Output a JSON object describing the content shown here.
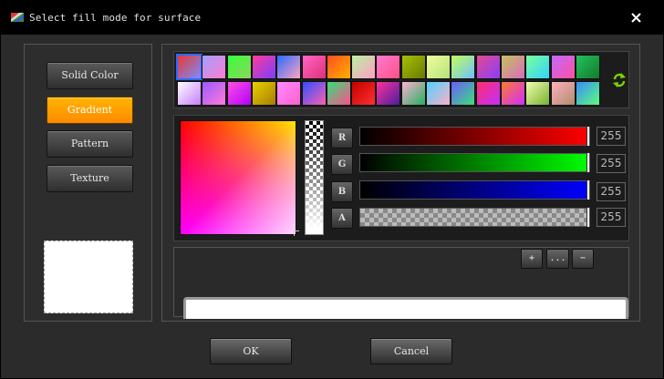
{
  "window": {
    "title": "Select fill mode for surface"
  },
  "fill_modes": [
    {
      "label": "Solid Color",
      "active": false
    },
    {
      "label": "Gradient",
      "active": true
    },
    {
      "label": "Pattern",
      "active": false
    },
    {
      "label": "Texture",
      "active": false
    }
  ],
  "channels": [
    {
      "label": "R",
      "value": "255",
      "fill": "linear-gradient(to right, #000000, #ff0000)"
    },
    {
      "label": "G",
      "value": "255",
      "fill": "linear-gradient(to right, #000000, #00ff00)"
    },
    {
      "label": "B",
      "value": "255",
      "fill": "linear-gradient(to right, #000000, #0000ff)"
    },
    {
      "label": "A",
      "value": "255",
      "fill": "alpha"
    }
  ],
  "gradient_buttons": {
    "add": "+",
    "more": "...",
    "remove": "−"
  },
  "dialog_buttons": {
    "ok": "OK",
    "cancel": "Cancel"
  },
  "colors": {
    "accent": "#ff9c00",
    "selected_outline": "#2a6bff",
    "refresh_icon": "#7bd400"
  },
  "icons": {
    "close": "close-icon",
    "refresh": "refresh-icon",
    "app": "app-icon"
  },
  "swatches": [
    [
      "#e53935",
      "#7b8cff"
    ],
    [
      "#a0a0ff",
      "#ff7bd0"
    ],
    [
      "#36ff3a",
      "#8fd45c"
    ],
    [
      "#ff3d9a",
      "#7a3dff"
    ],
    [
      "#2b6bff",
      "#ffa3c0"
    ],
    [
      "#ff66c4",
      "#e02f7a"
    ],
    [
      "#ff4f1f",
      "#ffb000"
    ],
    [
      "#b9f2a0",
      "#ff9dc5"
    ],
    [
      "#ff7bd1",
      "#ff4f88"
    ],
    [
      "#a5c000",
      "#6b7a00"
    ],
    [
      "#f0ff9a",
      "#b4e27c"
    ],
    [
      "#c3ff5a",
      "#6ec0ff"
    ],
    [
      "#e34b8f",
      "#8a3cff"
    ],
    [
      "#c7c35a",
      "#d96ac0"
    ],
    [
      "#7cff9a",
      "#2fd3ff"
    ],
    [
      "#c06aff",
      "#ff4fa0"
    ],
    [
      "#22c25a",
      "#157a2e"
    ],
    [
      "#ffffff",
      "#c67cff"
    ],
    [
      "#9b59ff",
      "#ff7bd8"
    ],
    [
      "#ff4fe0",
      "#b300ff"
    ],
    [
      "#e8d000",
      "#a87c00"
    ],
    [
      "#ff8cff",
      "#ff5fd0"
    ],
    [
      "#2e50ff",
      "#ff5fb0"
    ],
    [
      "#33e07a",
      "#ff4f8a"
    ],
    [
      "#c40000",
      "#ff2f2f"
    ],
    [
      "#ff2f9a",
      "#4a1fa0"
    ],
    [
      "#ffb0d0",
      "#22b060"
    ],
    [
      "#4dd3ff",
      "#ffb0c8"
    ],
    [
      "#6a5cff",
      "#3de07a"
    ],
    [
      "#ff2f6a",
      "#c02fff"
    ],
    [
      "#ff7a2f",
      "#d02fff"
    ],
    [
      "#f0ffb0",
      "#7ab02f"
    ],
    [
      "#ffb0c0",
      "#b08c6a"
    ],
    [
      "#3a8cff",
      "#5cff7a"
    ]
  ]
}
